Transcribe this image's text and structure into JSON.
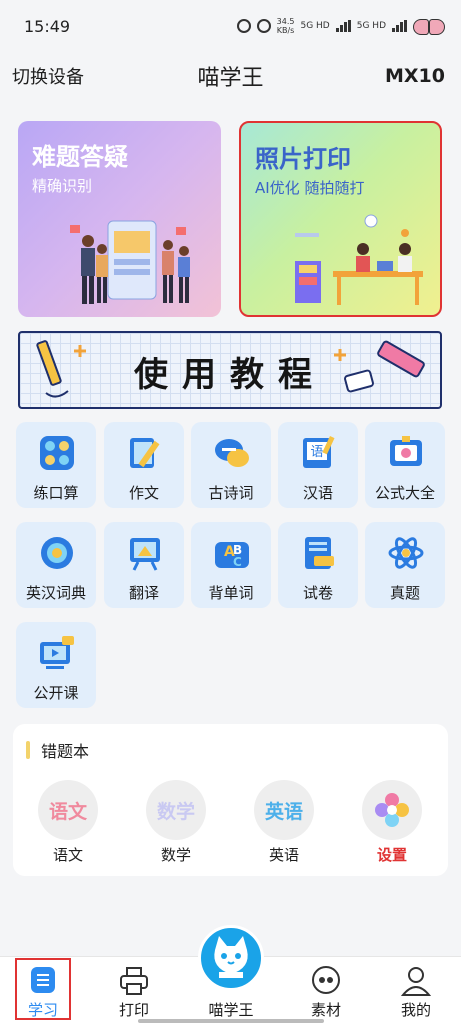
{
  "status": {
    "time": "15:49",
    "speed_value": "34.5",
    "speed_unit": "KB/s",
    "net1": "5G HD",
    "net2": "5G HD"
  },
  "header": {
    "left": "切换设备",
    "title": "喵学王",
    "right": "MX10"
  },
  "cards": [
    {
      "title": "难题答疑",
      "subtitle": "精确识别"
    },
    {
      "title": "照片打印",
      "subtitle": "AI优化 随拍随打"
    }
  ],
  "banner": {
    "text": "使用教程"
  },
  "tools": [
    {
      "label": "练口算",
      "icon": "abacus-icon"
    },
    {
      "label": "作文",
      "icon": "notebook-pen-icon"
    },
    {
      "label": "古诗词",
      "icon": "chat-bubbles-icon"
    },
    {
      "label": "汉语",
      "icon": "chinese-dictionary-icon"
    },
    {
      "label": "公式大全",
      "icon": "id-card-icon"
    },
    {
      "label": "英汉词典",
      "icon": "globe-icon"
    },
    {
      "label": "翻译",
      "icon": "easel-icon"
    },
    {
      "label": "背单词",
      "icon": "abc-letters-icon"
    },
    {
      "label": "试卷",
      "icon": "new-document-icon"
    },
    {
      "label": "真题",
      "icon": "atom-icon"
    },
    {
      "label": "公开课",
      "icon": "video-screen-icon"
    }
  ],
  "wrong_book": {
    "title": "错题本",
    "subjects": [
      {
        "label": "语文",
        "circle_text": "语文",
        "color": "#f08a9e"
      },
      {
        "label": "数学",
        "circle_text": "数学",
        "color": "#c9c9f2"
      },
      {
        "label": "英语",
        "circle_text": "英语",
        "color": "#4db0ea"
      },
      {
        "label": "设置",
        "circle_text": "",
        "color": "#e03333"
      }
    ]
  },
  "tabbar": [
    {
      "label": "学习",
      "icon": "study-icon"
    },
    {
      "label": "打印",
      "icon": "printer-icon"
    },
    {
      "label": "喵学王",
      "icon": "cat-logo-icon"
    },
    {
      "label": "素材",
      "icon": "quote-bubble-icon"
    },
    {
      "label": "我的",
      "icon": "user-icon"
    }
  ],
  "colors": {
    "accent": "#1aa3e8",
    "highlight": "#e03333",
    "tile_bg": "#e2eefb"
  }
}
